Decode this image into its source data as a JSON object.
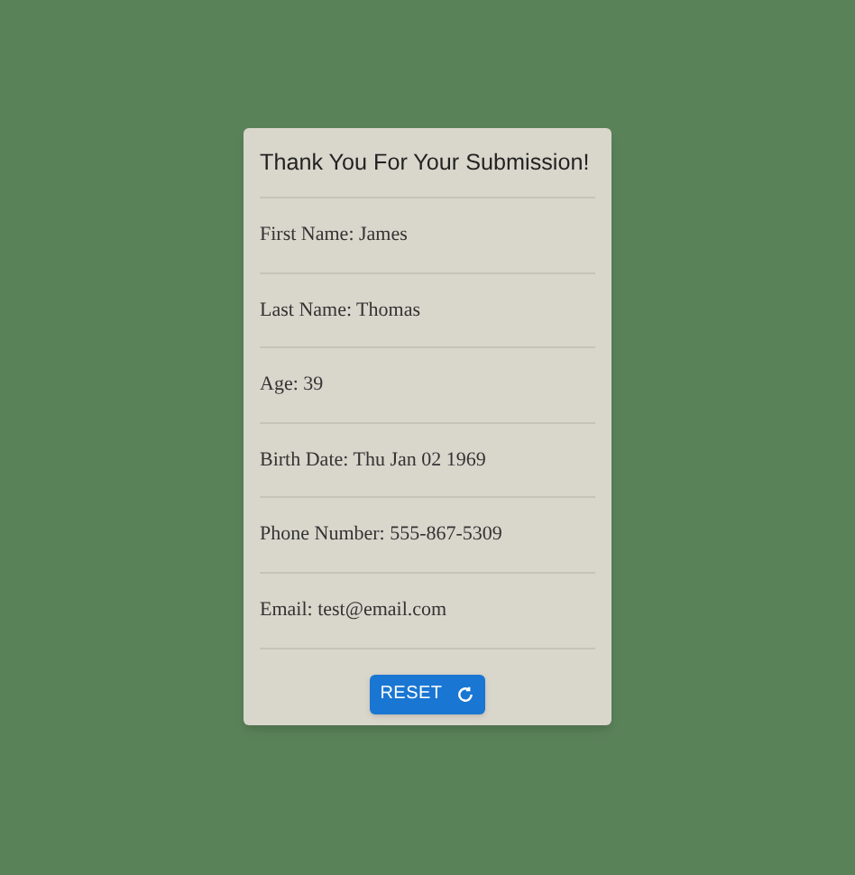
{
  "title": "Thank You For Your Submission!",
  "fields": [
    "First Name: James",
    "Last Name: Thomas",
    "Age: 39",
    "Birth Date: Thu Jan 02 1969",
    "Phone Number: 555-867-5309",
    "Email: test@email.com"
  ],
  "button": {
    "label": "RESET"
  }
}
